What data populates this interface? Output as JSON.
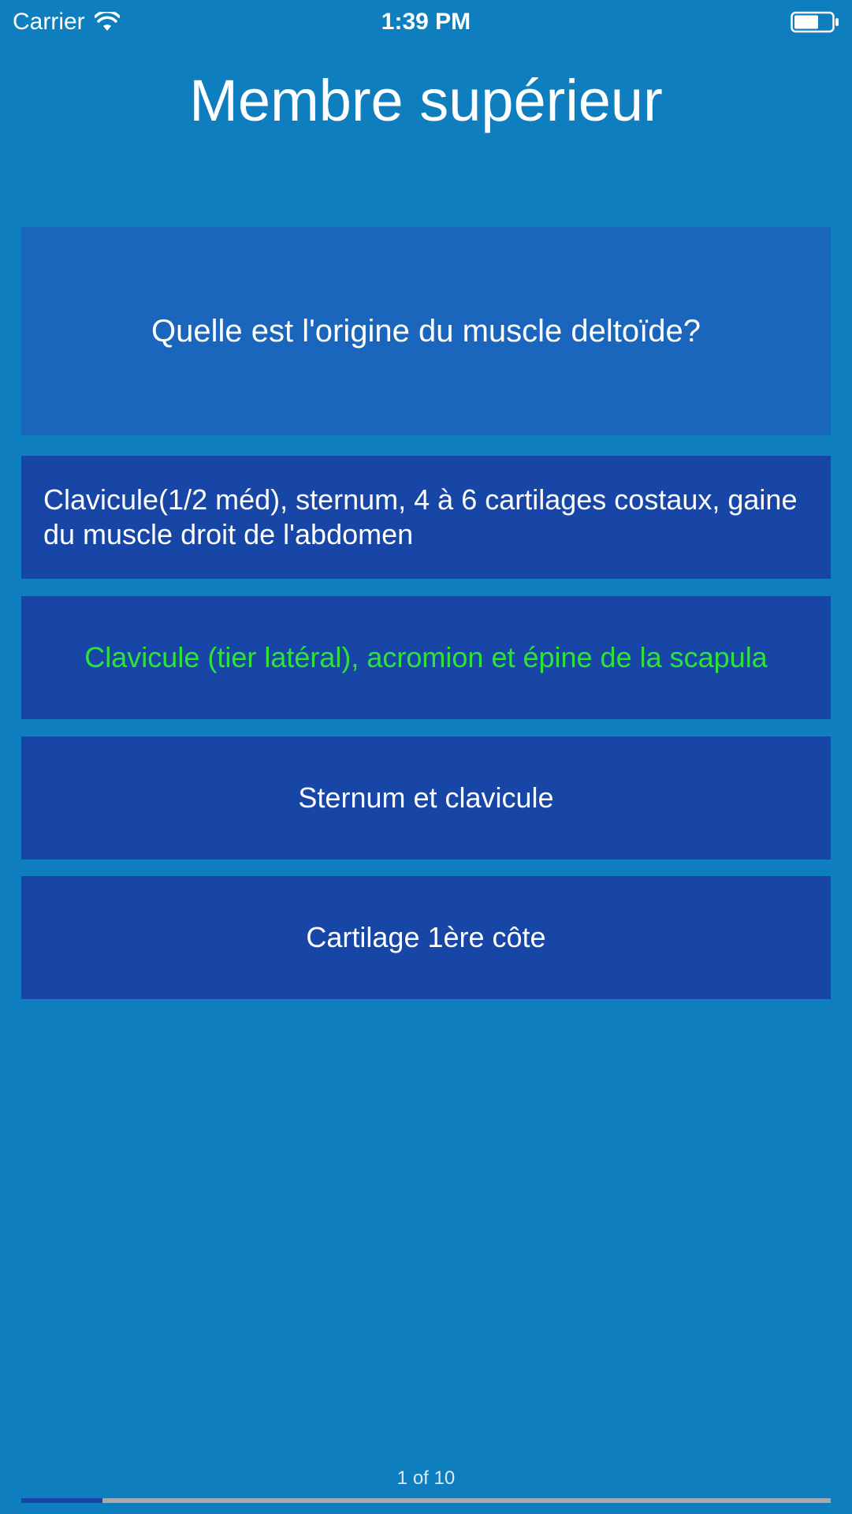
{
  "status_bar": {
    "carrier": "Carrier",
    "time": "1:39 PM",
    "icons": [
      "wifi-icon",
      "battery-icon"
    ]
  },
  "title": "Membre supérieur",
  "question": "Quelle est l'origine du muscle deltoïde?",
  "answers": [
    {
      "label": "Clavicule(1/2 méd), sternum, 4 à 6 cartilages costaux, gaine du muscle droit de l'abdomen",
      "correct": false
    },
    {
      "label": "Clavicule (tier latéral), acromion et épine de la scapula",
      "correct": true
    },
    {
      "label": "Sternum et clavicule",
      "correct": false
    },
    {
      "label": "Cartilage 1ère côte",
      "correct": false
    }
  ],
  "progress": {
    "label": "1 of 10",
    "current": 1,
    "total": 10
  },
  "colors": {
    "background": "#0f7ebf",
    "question_card": "#1a66bd",
    "answer_card": "#1746a6",
    "correct_text": "#2ee23a"
  }
}
